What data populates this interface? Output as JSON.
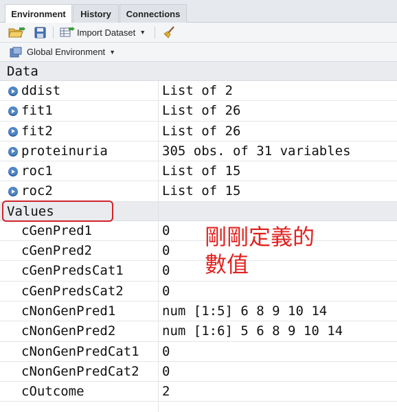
{
  "tabs": [
    {
      "label": "Environment",
      "active": true
    },
    {
      "label": "History",
      "active": false
    },
    {
      "label": "Connections",
      "active": false
    }
  ],
  "toolbar": {
    "open_icon": "open-folder-icon",
    "save_icon": "save-disk-icon",
    "import_label": "Import Dataset",
    "broom_icon": "broom-icon"
  },
  "environment": {
    "selector_label": "Global Environment"
  },
  "data_section": {
    "heading": "Data",
    "rows": [
      {
        "name": "ddist",
        "value": "List of 2"
      },
      {
        "name": "fit1",
        "value": "List of 26"
      },
      {
        "name": "fit2",
        "value": "List of 26"
      },
      {
        "name": "proteinuria",
        "value": "305 obs. of 31 variables"
      },
      {
        "name": "roc1",
        "value": "List of 15"
      },
      {
        "name": "roc2",
        "value": "List of 15"
      }
    ]
  },
  "values_section": {
    "heading": "Values",
    "rows": [
      {
        "name": "cGenPred1",
        "value": "0"
      },
      {
        "name": "cGenPred2",
        "value": "0"
      },
      {
        "name": "cGenPredsCat1",
        "value": "0"
      },
      {
        "name": "cGenPredsCat2",
        "value": "0"
      },
      {
        "name": "cNonGenPred1",
        "value": "num [1:5] 6 8 9 10 14"
      },
      {
        "name": "cNonGenPred2",
        "value": "num [1:6] 5 6 8 9 10 14"
      },
      {
        "name": "cNonGenPredCat1",
        "value": "0"
      },
      {
        "name": "cNonGenPredCat2",
        "value": "0"
      },
      {
        "name": "cOutcome",
        "value": "2"
      }
    ]
  },
  "annotation": {
    "line1": "剛剛定義的",
    "line2": "數值",
    "color": "#e0231f"
  }
}
